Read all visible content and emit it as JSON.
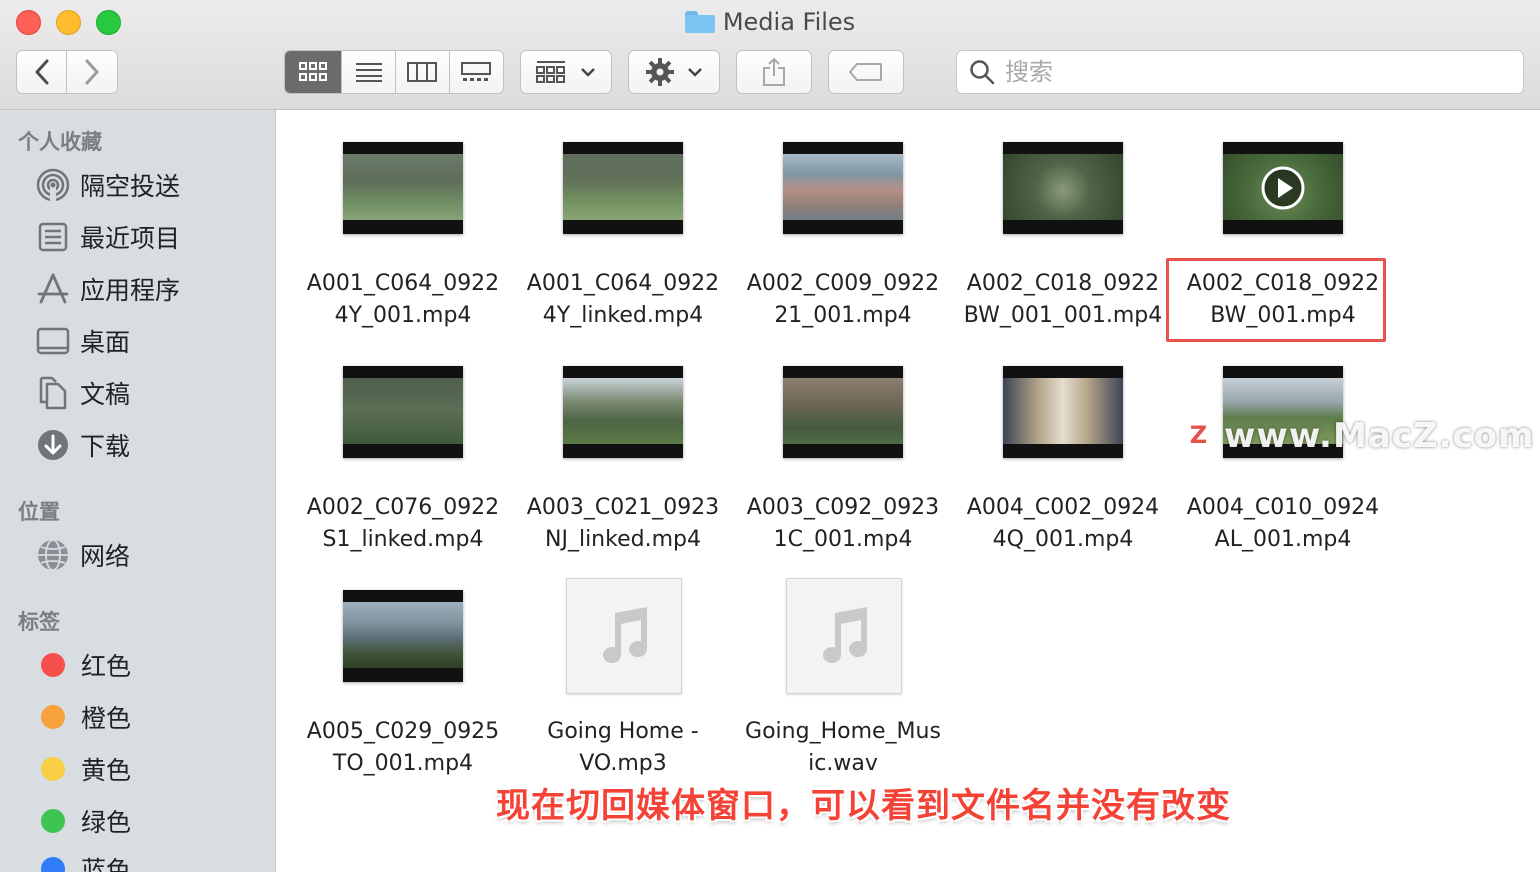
{
  "window": {
    "title": "Media Files"
  },
  "toolbar": {
    "view_modes": [
      "icon-view",
      "list-view",
      "column-view",
      "gallery-view"
    ],
    "active_view": "icon-view",
    "search_placeholder": "搜索"
  },
  "sidebar": {
    "favorites_heading": "个人收藏",
    "favorites": [
      {
        "label": "隔空投送",
        "icon": "airdrop-icon"
      },
      {
        "label": "最近项目",
        "icon": "recents-icon"
      },
      {
        "label": "应用程序",
        "icon": "applications-icon"
      },
      {
        "label": "桌面",
        "icon": "desktop-icon"
      },
      {
        "label": "文稿",
        "icon": "documents-icon"
      },
      {
        "label": "下载",
        "icon": "downloads-icon"
      }
    ],
    "locations_heading": "位置",
    "locations": [
      {
        "label": "网络",
        "icon": "network-icon"
      }
    ],
    "tags_heading": "标签",
    "tags": [
      {
        "label": "红色",
        "color": "#f74f4b"
      },
      {
        "label": "橙色",
        "color": "#f7a23b"
      },
      {
        "label": "黄色",
        "color": "#f8cf45"
      },
      {
        "label": "绿色",
        "color": "#3dc453"
      },
      {
        "label": "蓝色",
        "color": "#2f7cf6"
      }
    ]
  },
  "files": [
    {
      "line1": "A001_C064_0922",
      "line2": "4Y_001.mp4",
      "type": "video"
    },
    {
      "line1": "A001_C064_0922",
      "line2": "4Y_linked.mp4",
      "type": "video"
    },
    {
      "line1": "A002_C009_0922",
      "line2": "21_001.mp4",
      "type": "video"
    },
    {
      "line1": "A002_C018_0922",
      "line2": "BW_001_001.mp4",
      "type": "video"
    },
    {
      "line1": "A002_C018_0922",
      "line2": "BW_001.mp4",
      "type": "video",
      "selected": true
    },
    {
      "line1": "A002_C076_0922",
      "line2": "S1_linked.mp4",
      "type": "video"
    },
    {
      "line1": "A003_C021_0923",
      "line2": "NJ_linked.mp4",
      "type": "video"
    },
    {
      "line1": "A003_C092_0923",
      "line2": "1C_001.mp4",
      "type": "video"
    },
    {
      "line1": "A004_C002_0924",
      "line2": "4Q_001.mp4",
      "type": "video"
    },
    {
      "line1": "A004_C010_0924",
      "line2": "AL_001.mp4",
      "type": "video"
    },
    {
      "line1": "A005_C029_0925",
      "line2": "TO_001.mp4",
      "type": "video"
    },
    {
      "line1": "Going Home -",
      "line2": "VO.mp3",
      "type": "audio"
    },
    {
      "line1": "Going_Home_Mus",
      "line2": "ic.wav",
      "type": "audio"
    }
  ],
  "watermark": {
    "badge": "Z",
    "text": "www.MacZ.com"
  },
  "caption": "现在切回媒体窗口，可以看到文件名并没有改变",
  "colors": {
    "selection": "#e5534b",
    "caption": "#f44336"
  }
}
